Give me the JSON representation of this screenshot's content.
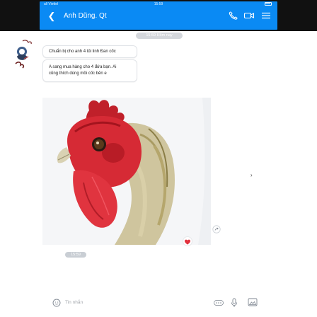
{
  "status_bar": {
    "carrier": "all Viettel",
    "time": "15:59",
    "battery_percent": 90
  },
  "header": {
    "title": "Anh Dũng. Qt",
    "back_icon": "back-arrow-icon",
    "call_icon": "phone-icon",
    "video_icon": "video-icon",
    "menu_icon": "hamburger-menu-icon",
    "bar_color": "#0a8af4"
  },
  "conversation": {
    "date_label": "15:59 Hôm nay",
    "messages": [
      {
        "text": "Chuẩn bị cho anh 4 tủi linh Đan cốc"
      },
      {
        "lines": [
          "A sang mua hàng cho 4 đứa bạn. Ai",
          "cũng thích dùng mồi cốc bên e"
        ]
      }
    ],
    "photo": {
      "subject": "rooster-head-closeup",
      "time_label": "15:59"
    },
    "reaction_icon": "heart-icon",
    "share_icon": "share-icon",
    "scroll_arrow_icon": "chevron-right-icon"
  },
  "composer": {
    "emoji_icon": "emoji-icon",
    "placeholder": "Tin nhắn",
    "more_icon": "more-dots-icon",
    "mic_icon": "microphone-icon",
    "image_icon": "image-icon"
  }
}
